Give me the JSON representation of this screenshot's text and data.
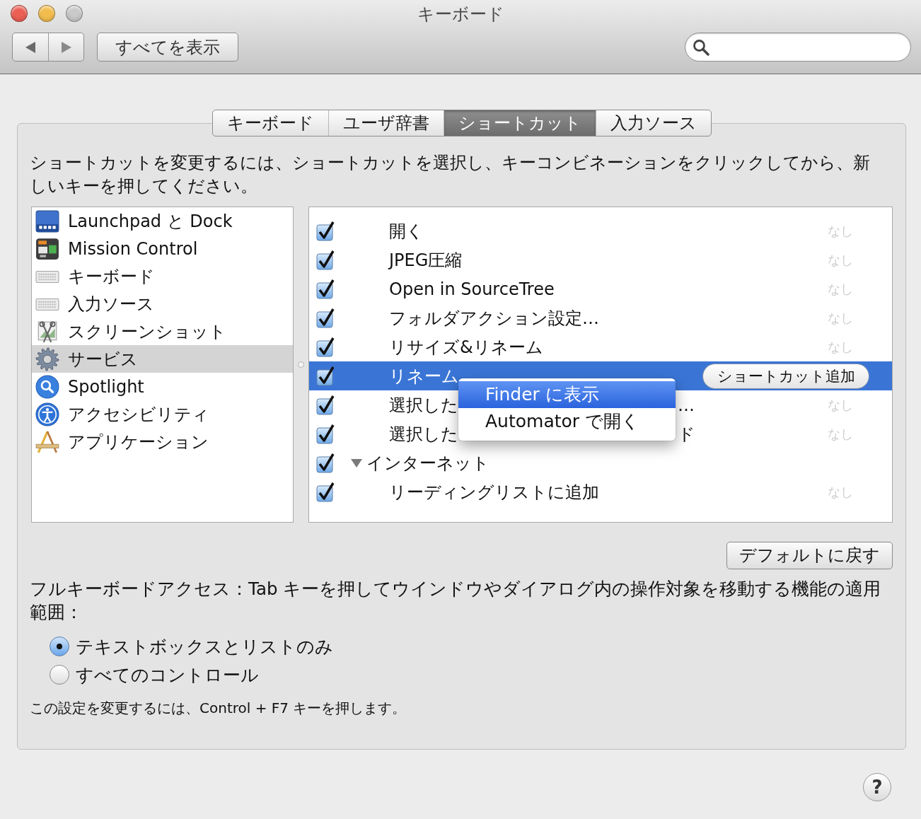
{
  "window": {
    "title": "キーボード",
    "traffic_lights": [
      {
        "kind": "close",
        "disabled": false
      },
      {
        "kind": "minimize",
        "disabled": false
      },
      {
        "kind": "zoom",
        "disabled": true
      }
    ]
  },
  "toolbar": {
    "show_all_button": "すべてを表示"
  },
  "tabs": [
    {
      "label": "キーボード",
      "selected": false
    },
    {
      "label": "ユーザ辞書",
      "selected": false
    },
    {
      "label": "ショートカット",
      "selected": true
    },
    {
      "label": "入力ソース",
      "selected": false
    }
  ],
  "instructions": "ショートカットを変更するには、ショートカットを選択し、キーコンビネーションをクリックしてから、新しいキーを押してください。",
  "categories": [
    {
      "label": "Launchpad と Dock",
      "selected": false
    },
    {
      "label": "Mission Control",
      "selected": false
    },
    {
      "label": "キーボード",
      "selected": false
    },
    {
      "label": "入力ソース",
      "selected": false
    },
    {
      "label": "スクリーンショット",
      "selected": false
    },
    {
      "label": "サービス",
      "selected": true
    },
    {
      "label": "Spotlight",
      "selected": false
    },
    {
      "label": "アクセシビリティ",
      "selected": false
    },
    {
      "label": "アプリケーション",
      "selected": false
    }
  ],
  "services": [
    {
      "kind": "service",
      "label": "開く",
      "checked": true,
      "selected": false,
      "shortcut": "なし"
    },
    {
      "kind": "service",
      "label": "JPEG圧縮",
      "checked": true,
      "selected": false,
      "shortcut": "なし"
    },
    {
      "kind": "service",
      "label": "Open in SourceTree",
      "checked": true,
      "selected": false,
      "shortcut": "なし"
    },
    {
      "kind": "service",
      "label": "フォルダアクション設定…",
      "checked": true,
      "selected": false,
      "shortcut": "なし"
    },
    {
      "kind": "service",
      "label": "リサイズ&リネーム",
      "checked": true,
      "selected": false,
      "shortcut": "なし"
    },
    {
      "kind": "service",
      "label": "リネーム",
      "checked": true,
      "selected": true,
      "add_button": "ショートカット追加"
    },
    {
      "kind": "service",
      "label": "選択した",
      "label_tail": "…",
      "checked": true,
      "selected": false,
      "shortcut": "なし"
    },
    {
      "kind": "service",
      "label": "選択した",
      "label_tail": "ド",
      "checked": true,
      "selected": false,
      "shortcut": "なし"
    },
    {
      "kind": "group",
      "label": "インターネット",
      "checked": true,
      "selected": false,
      "expanded": true
    },
    {
      "kind": "service",
      "label": "リーディングリストに追加",
      "checked": true,
      "selected": false,
      "shortcut": "なし"
    }
  ],
  "context_menu": [
    {
      "label": "Finder に表示",
      "selected": true
    },
    {
      "label": "Automator で開く",
      "selected": false
    }
  ],
  "restore_defaults_button": "デフォルトに戻す",
  "full_keyboard_access": {
    "label": "フルキーボードアクセス：Tab キーを押してウインドウやダイアログ内の操作対象を移動する機能の適用範囲：",
    "options": [
      {
        "label": "テキストボックスとリストのみ",
        "selected": true
      },
      {
        "label": "すべてのコントロール",
        "selected": false
      }
    ],
    "note": "この設定を変更するには、Control + F7 キーを押します。"
  },
  "help_button": "?"
}
